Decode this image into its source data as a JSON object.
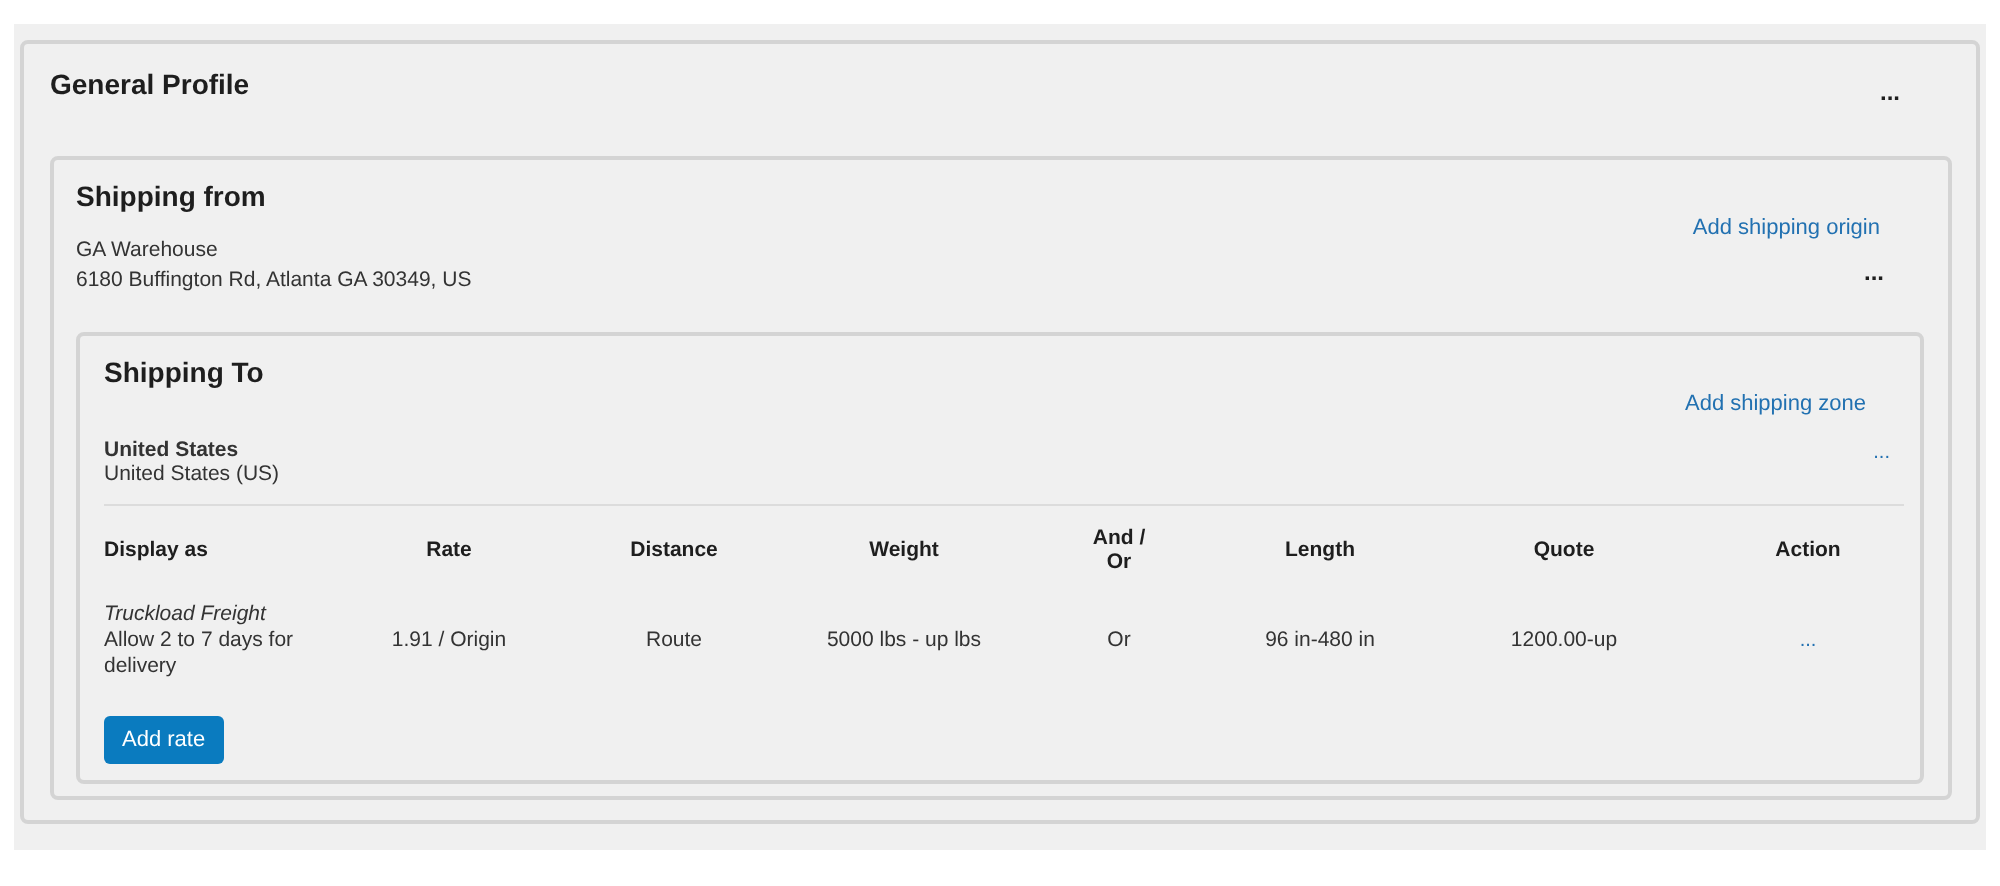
{
  "profile": {
    "title": "General Profile",
    "menu": "..."
  },
  "origin": {
    "title": "Shipping from",
    "link": "Add shipping origin",
    "menu": "...",
    "name": "GA Warehouse",
    "address": "6180 Buffington Rd, Atlanta GA 30349, US"
  },
  "zone": {
    "title": "Shipping To",
    "link": "Add shipping zone",
    "name": "United States",
    "region": "United States (US)",
    "menu": "..."
  },
  "table": {
    "columns": [
      "Display as",
      "Rate",
      "Distance",
      "Weight",
      "And / Or",
      "Length",
      "Quote",
      "Action"
    ],
    "rows": [
      {
        "name": "Truckload Freight",
        "description": "Allow 2 to 7 days for delivery",
        "rate": "1.91 / Origin",
        "distance": "Route",
        "weight": "5000 lbs - up lbs",
        "and_or": "Or",
        "length": "96 in-480 in",
        "quote": "1200.00-up",
        "action": "..."
      }
    ]
  },
  "add_button": "Add rate"
}
